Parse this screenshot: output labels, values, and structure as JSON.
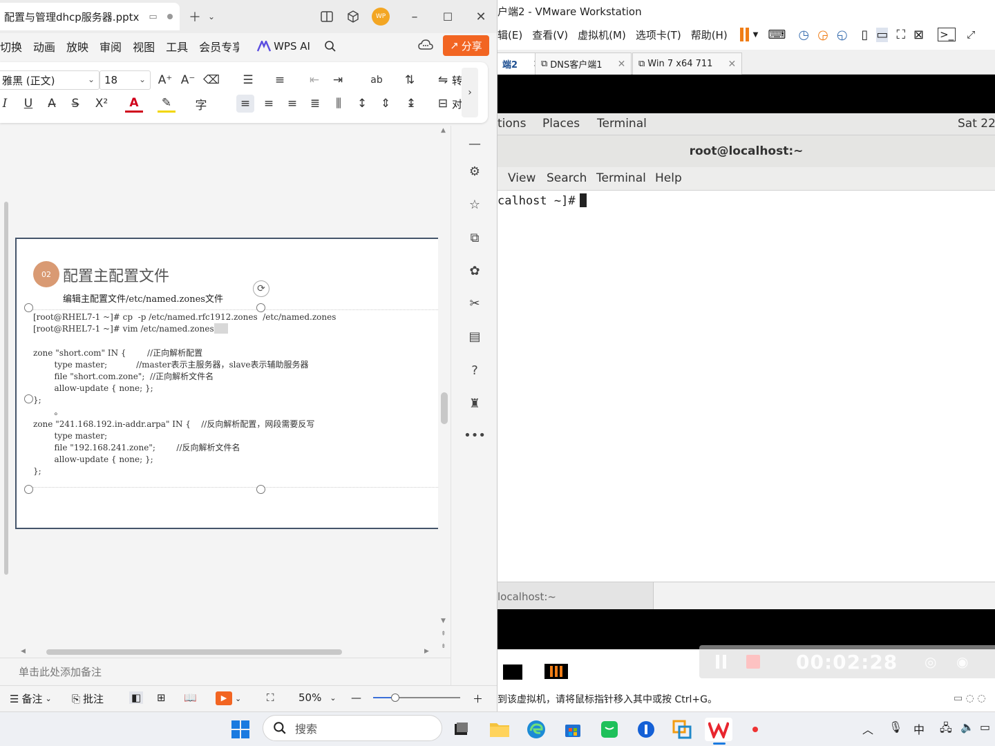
{
  "wps": {
    "file_name": "配置与管理dhcp服务器.pptx",
    "menu": [
      "切换",
      "动画",
      "放映",
      "审阅",
      "视图",
      "工具",
      "会员专享"
    ],
    "wps_ai": "WPS AI",
    "share": "分享",
    "font_name": "雅黑 (正文)",
    "font_size": "18",
    "ribbon_cut_labels": [
      "转",
      "对"
    ],
    "slide": {
      "number": "02",
      "title": "配置主配置文件",
      "subtitle": "编辑主配置文件/etc/named.zones文件",
      "code_lines": [
        "[root@RHEL7-1 ~]# cp  -p /etc/named.rfc1912.zones  /etc/named.zones",
        "[root@RHEL7-1 ~]# vim /etc/named.zones",
        "",
        "zone \"short.com\" IN {        //正向解析配置",
        "        type master;           //master表示主服务器，slave表示辅助服务器",
        "        file \"short.com.zone\";  //正向解析文件名",
        "        allow-update { none; };",
        "};",
        "        。",
        "zone \"241.168.192.in-addr.arpa\" IN {    //反向解析配置，网段需要反写",
        "        type master;",
        "        file \"192.168.241.zone\";        //反向解析文件名",
        "        allow-update { none; };",
        "};"
      ]
    },
    "notes_placeholder": "单击此处添加备注",
    "status": {
      "notes": "备注",
      "comments": "批注",
      "zoom": "50%"
    }
  },
  "vmware": {
    "title": "户端2 - VMware Workstation",
    "menu": [
      "辑(E)",
      "查看(V)",
      "虚拟机(M)",
      "选项卡(T)",
      "帮助(H)"
    ],
    "tabs": [
      {
        "label": "端2",
        "active": true
      },
      {
        "label": "DNS客户端1",
        "active": false
      },
      {
        "label": "Win 7 x64 711",
        "active": false
      }
    ],
    "gnome_bar": {
      "items": [
        "tions",
        "Places",
        "Terminal"
      ],
      "clock": "Sat 22:"
    },
    "terminal": {
      "title": "root@localhost:~",
      "menu": [
        "View",
        "Search",
        "Terminal",
        "Help"
      ],
      "prompt": "calhost ~]#"
    },
    "task_tab": "localhost:~",
    "recording_time": "00:02:28",
    "status_text": "到该虚拟机，请将鼠标指针移入其中或按 Ctrl+G。"
  },
  "taskbar": {
    "search_placeholder": "搜索",
    "tray_ime": "中"
  },
  "colors": {
    "wps_accent": "#f26522",
    "slide_circle": "#d99a73",
    "vm_pause": "#f07d16"
  }
}
